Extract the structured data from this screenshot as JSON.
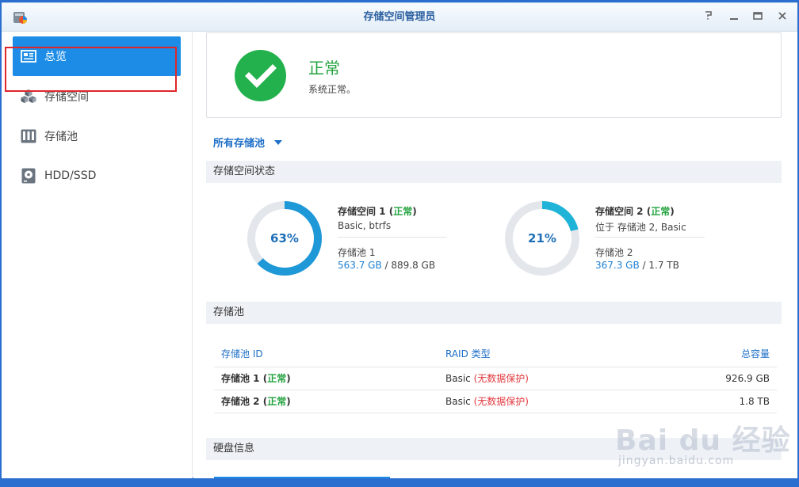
{
  "window": {
    "title": "存储空间管理员",
    "buttons": [
      "help-icon",
      "minimize-icon",
      "maximize-icon",
      "close-icon"
    ]
  },
  "sidebar": {
    "items": [
      {
        "label": "总览",
        "icon": "overview-icon",
        "active": true
      },
      {
        "label": "存储空间",
        "icon": "volume-cubes-icon",
        "active": false
      },
      {
        "label": "存储池",
        "icon": "storage-pool-icon",
        "active": false
      },
      {
        "label": "HDD/SSD",
        "icon": "disk-icon",
        "active": false
      }
    ]
  },
  "status": {
    "title": "正常",
    "description": "系统正常。"
  },
  "filter": {
    "label": "所有存储池"
  },
  "sections": {
    "volume_status": "存储空间状态",
    "storage_pool": "存储池",
    "disk_info": "硬盘信息"
  },
  "volumes": [
    {
      "name": "存储空间 1 (",
      "status": "正常",
      "close": ")",
      "sub": "Basic, btrfs",
      "pool": "存储池 1",
      "used": "563.7 GB",
      "total": " / 889.8 GB",
      "percent_label": "63%",
      "percent": 63
    },
    {
      "name": "存储空间 2 (",
      "status": "正常",
      "close": ")",
      "sub": "位于 存储池 2, Basic",
      "pool": "存储池 2",
      "used": "367.3 GB",
      "total": " / 1.7 TB",
      "percent_label": "21%",
      "percent": 21
    }
  ],
  "pool_table": {
    "headers": [
      "存储池 ID",
      "RAID 类型",
      "总容量"
    ],
    "rows": [
      {
        "id": "存储池 1 (",
        "status": "正常",
        "close": ")",
        "raid": "Basic ",
        "protect": "(无数据保护)",
        "capacity": "926.9 GB"
      },
      {
        "id": "存储池 2 (",
        "status": "正常",
        "close": ")",
        "raid": "Basic ",
        "protect": "(无数据保护)",
        "capacity": "1.8 TB"
      }
    ]
  },
  "watermark": {
    "brand": "Bai du 经验",
    "url": "jingyan.baidu.com"
  },
  "colors": {
    "accent": "#1c8ce6",
    "ok_green": "#23a33f",
    "warn_red": "#e0383d",
    "ring_bg": "#e3e7ec"
  }
}
